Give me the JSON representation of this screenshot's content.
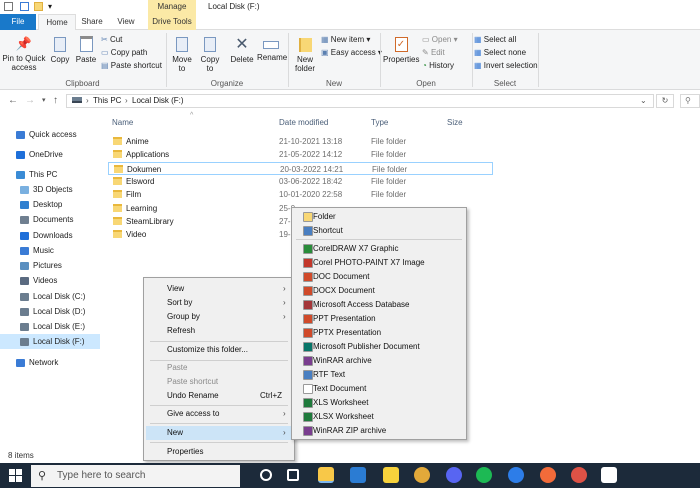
{
  "titlebar": {
    "manage": "Manage",
    "title": "Local Disk (F:)"
  },
  "tabs": {
    "file": "File",
    "home": "Home",
    "share": "Share",
    "view": "View",
    "drive_tools": "Drive Tools"
  },
  "ribbon": {
    "pin": "Pin to Quick access",
    "copy": "Copy",
    "paste": "Paste",
    "cut": "Cut",
    "copy_path": "Copy path",
    "paste_shortcut": "Paste shortcut",
    "clipboard": "Clipboard",
    "move_to": "Move to",
    "copy_to": "Copy to",
    "delete": "Delete",
    "rename": "Rename",
    "organize": "Organize",
    "new_folder": "New folder",
    "new_item": "New item",
    "easy_access": "Easy access",
    "new": "New",
    "properties": "Properties",
    "open": "Open",
    "edit": "Edit",
    "history": "History",
    "open_group": "Open",
    "select_all": "Select all",
    "select_none": "Select none",
    "invert_selection": "Invert selection",
    "select": "Select"
  },
  "address": {
    "this_pc": "This PC",
    "drive": "Local Disk (F:)"
  },
  "nav": [
    {
      "label": "Quick access",
      "icon": "star-icon"
    },
    {
      "label": "OneDrive",
      "icon": "cloud-icon"
    },
    {
      "label": "This PC",
      "icon": "computer-icon"
    },
    {
      "label": "3D Objects",
      "icon": "cube-icon"
    },
    {
      "label": "Desktop",
      "icon": "desktop-icon"
    },
    {
      "label": "Documents",
      "icon": "document-icon"
    },
    {
      "label": "Downloads",
      "icon": "download-icon"
    },
    {
      "label": "Music",
      "icon": "music-icon"
    },
    {
      "label": "Pictures",
      "icon": "picture-icon"
    },
    {
      "label": "Videos",
      "icon": "video-icon"
    },
    {
      "label": "Local Disk (C:)",
      "icon": "drive-icon"
    },
    {
      "label": "Local Disk (D:)",
      "icon": "drive-icon"
    },
    {
      "label": "Local Disk (E:)",
      "icon": "drive-icon"
    },
    {
      "label": "Local Disk (F:)",
      "icon": "drive-icon"
    },
    {
      "label": "Network",
      "icon": "network-icon"
    }
  ],
  "columns": {
    "name": "Name",
    "date": "Date modified",
    "type": "Type",
    "size": "Size"
  },
  "files": [
    {
      "name": "Anime",
      "date": "21-10-2021 13:18",
      "type": "File folder"
    },
    {
      "name": "Applications",
      "date": "21-05-2022 14:12",
      "type": "File folder"
    },
    {
      "name": "Dokumen",
      "date": "20-03-2022 14:21",
      "type": "File folder"
    },
    {
      "name": "Elsword",
      "date": "03-06-2022 18:42",
      "type": "File folder"
    },
    {
      "name": "Film",
      "date": "10-01-2020 22:58",
      "type": "File folder"
    },
    {
      "name": "Learning",
      "date": "25-0",
      "type": ""
    },
    {
      "name": "SteamLibrary",
      "date": "27-",
      "type": ""
    },
    {
      "name": "Video",
      "date": "19-",
      "type": ""
    }
  ],
  "status": "8 items",
  "context_menu": {
    "view": "View",
    "sort_by": "Sort by",
    "group_by": "Group by",
    "refresh": "Refresh",
    "customize": "Customize this folder...",
    "paste": "Paste",
    "paste_shortcut": "Paste shortcut",
    "undo_rename": "Undo Rename",
    "undo_shortcut": "Ctrl+Z",
    "give_access": "Give access to",
    "new": "New",
    "properties": "Properties"
  },
  "new_submenu": [
    {
      "label": "Folder",
      "icon": "folder-icon",
      "color": "#f8d775"
    },
    {
      "label": "Shortcut",
      "icon": "shortcut-icon",
      "color": "#4a7fc1"
    },
    {
      "label": "CorelDRAW X7 Graphic",
      "icon": "coreldraw-icon",
      "color": "#2a8c3a"
    },
    {
      "label": "Corel PHOTO-PAINT X7 Image",
      "icon": "photopaint-icon",
      "color": "#c2372b"
    },
    {
      "label": "DOC Document",
      "icon": "doc-icon",
      "color": "#d04a2a"
    },
    {
      "label": "DOCX Document",
      "icon": "docx-icon",
      "color": "#d04a2a"
    },
    {
      "label": "Microsoft Access Database",
      "icon": "access-icon",
      "color": "#a4373a"
    },
    {
      "label": "PPT Presentation",
      "icon": "ppt-icon",
      "color": "#d04a2a"
    },
    {
      "label": "PPTX Presentation",
      "icon": "pptx-icon",
      "color": "#d04a2a"
    },
    {
      "label": "Microsoft Publisher Document",
      "icon": "publisher-icon",
      "color": "#077568"
    },
    {
      "label": "WinRAR archive",
      "icon": "winrar-icon",
      "color": "#7a3e8f"
    },
    {
      "label": "RTF Text",
      "icon": "rtf-icon",
      "color": "#4a7fc1"
    },
    {
      "label": "Text Document",
      "icon": "text-icon",
      "color": "#ffffff"
    },
    {
      "label": "XLS Worksheet",
      "icon": "xls-icon",
      "color": "#1f7a3c"
    },
    {
      "label": "XLSX Worksheet",
      "icon": "xlsx-icon",
      "color": "#1f7a3c"
    },
    {
      "label": "WinRAR ZIP archive",
      "icon": "winrar-zip-icon",
      "color": "#7a3e8f"
    }
  ],
  "taskbar": {
    "search_placeholder": "Type here to search",
    "apps": [
      {
        "icon": "cortana-icon",
        "color": "#ffffff"
      },
      {
        "icon": "task-view-icon",
        "color": "#ffffff"
      },
      {
        "icon": "file-explorer-icon",
        "color": "#f8c848"
      },
      {
        "icon": "word-icon",
        "color": "#2b7cd3"
      },
      {
        "icon": "sticky-notes-icon",
        "color": "#f7d23c"
      },
      {
        "icon": "chrome-icon",
        "color": "#e2a93a"
      },
      {
        "icon": "discord-icon",
        "color": "#5865f2"
      },
      {
        "icon": "spotify-icon",
        "color": "#1db954"
      },
      {
        "icon": "wps-icon",
        "color": "#2d7de8"
      },
      {
        "icon": "brave-icon",
        "color": "#f26b3a"
      },
      {
        "icon": "chrome-profile-icon",
        "color": "#de5246"
      },
      {
        "icon": "settings-icon",
        "color": "#ffffff"
      }
    ]
  }
}
